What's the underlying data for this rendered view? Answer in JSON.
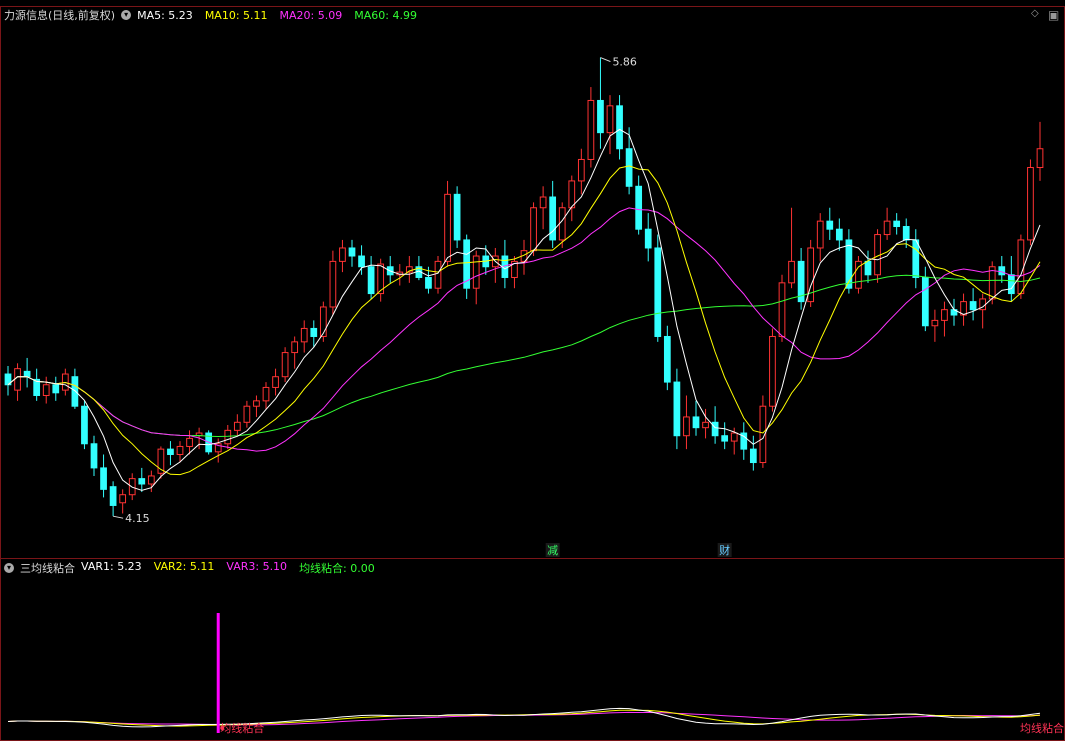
{
  "main": {
    "title": "力源信息(日线,前复权)",
    "ma_labels": [
      {
        "key": "MA5",
        "text": "MA5: 5.23",
        "color": "#ffffff"
      },
      {
        "key": "MA10",
        "text": "MA10: 5.11",
        "color": "#ffff00"
      },
      {
        "key": "MA20",
        "text": "MA20: 5.09",
        "color": "#ff33ff"
      },
      {
        "key": "MA60",
        "text": "MA60: 4.99",
        "color": "#33ff33"
      }
    ],
    "high_label": "5.86",
    "low_label": "4.15",
    "event_tags": [
      {
        "text": "减",
        "color": "#33ff66",
        "bar": 57
      },
      {
        "text": "财",
        "color": "#66ccff",
        "bar": 75
      }
    ]
  },
  "sub": {
    "title": "三均线粘合",
    "var_labels": [
      {
        "text": "VAR1: 5.23",
        "color": "#ffffff"
      },
      {
        "text": "VAR2: 5.11",
        "color": "#ffff00"
      },
      {
        "text": "VAR3: 5.10",
        "color": "#ff33ff"
      },
      {
        "text": "均线粘合: 0.00",
        "color": "#33ff33"
      }
    ],
    "signal_label": "均线粘合",
    "signals": [
      {
        "bar": 22,
        "label": "均线粘合"
      },
      {
        "bar": 116,
        "label": "均线粘合"
      }
    ]
  },
  "colors": {
    "up": "#ff3333",
    "down": "#33ffff",
    "frame": "#7a1518",
    "ma5": "#ffffff",
    "ma10": "#ffff00",
    "ma20": "#ff33ff",
    "ma60": "#33ff33",
    "signal": "#ff00ff",
    "signal_text": "#ff3355"
  },
  "chart_data": {
    "type": "candlestick",
    "series_count": 118,
    "y_range": [
      4.05,
      6.0
    ],
    "y_extremes": {
      "max": 5.86,
      "min": 4.15
    },
    "ohlc": [
      [
        4.68,
        4.71,
        4.6,
        4.64
      ],
      [
        4.62,
        4.72,
        4.58,
        4.7
      ],
      [
        4.69,
        4.74,
        4.63,
        4.67
      ],
      [
        4.66,
        4.7,
        4.58,
        4.6
      ],
      [
        4.6,
        4.67,
        4.57,
        4.64
      ],
      [
        4.64,
        4.67,
        4.58,
        4.61
      ],
      [
        4.62,
        4.7,
        4.6,
        4.68
      ],
      [
        4.67,
        4.7,
        4.55,
        4.56
      ],
      [
        4.56,
        4.58,
        4.4,
        4.42
      ],
      [
        4.42,
        4.45,
        4.3,
        4.33
      ],
      [
        4.33,
        4.38,
        4.22,
        4.25
      ],
      [
        4.26,
        4.28,
        4.15,
        4.19
      ],
      [
        4.2,
        4.25,
        4.16,
        4.23
      ],
      [
        4.23,
        4.31,
        4.21,
        4.29
      ],
      [
        4.29,
        4.33,
        4.24,
        4.27
      ],
      [
        4.27,
        4.32,
        4.24,
        4.3
      ],
      [
        4.31,
        4.41,
        4.29,
        4.4
      ],
      [
        4.4,
        4.43,
        4.34,
        4.38
      ],
      [
        4.38,
        4.43,
        4.35,
        4.41
      ],
      [
        4.41,
        4.47,
        4.38,
        4.44
      ],
      [
        4.45,
        4.48,
        4.4,
        4.46
      ],
      [
        4.46,
        4.47,
        4.38,
        4.39
      ],
      [
        4.39,
        4.44,
        4.35,
        4.42
      ],
      [
        4.42,
        4.49,
        4.4,
        4.47
      ],
      [
        4.47,
        4.53,
        4.45,
        4.5
      ],
      [
        4.5,
        4.58,
        4.48,
        4.56
      ],
      [
        4.56,
        4.6,
        4.52,
        4.58
      ],
      [
        4.58,
        4.65,
        4.55,
        4.63
      ],
      [
        4.63,
        4.7,
        4.6,
        4.67
      ],
      [
        4.67,
        4.78,
        4.65,
        4.76
      ],
      [
        4.76,
        4.82,
        4.7,
        4.8
      ],
      [
        4.8,
        4.88,
        4.76,
        4.85
      ],
      [
        4.85,
        4.88,
        4.78,
        4.82
      ],
      [
        4.82,
        4.95,
        4.8,
        4.93
      ],
      [
        4.93,
        5.14,
        4.9,
        5.1
      ],
      [
        5.1,
        5.18,
        5.06,
        5.15
      ],
      [
        5.15,
        5.18,
        5.08,
        5.12
      ],
      [
        5.12,
        5.16,
        5.05,
        5.08
      ],
      [
        5.08,
        5.12,
        4.96,
        4.98
      ],
      [
        4.98,
        5.11,
        4.95,
        5.09
      ],
      [
        5.08,
        5.12,
        5.02,
        5.05
      ],
      [
        5.05,
        5.09,
        5.01,
        5.06
      ],
      [
        5.06,
        5.12,
        5.02,
        5.08
      ],
      [
        5.08,
        5.12,
        5.03,
        5.04
      ],
      [
        5.04,
        5.08,
        4.98,
        5.0
      ],
      [
        5.0,
        5.12,
        4.98,
        5.1
      ],
      [
        5.1,
        5.4,
        5.08,
        5.35
      ],
      [
        5.35,
        5.38,
        5.15,
        5.18
      ],
      [
        5.18,
        5.2,
        4.96,
        5.0
      ],
      [
        5.0,
        5.14,
        4.94,
        5.12
      ],
      [
        5.12,
        5.16,
        5.05,
        5.08
      ],
      [
        5.08,
        5.15,
        5.02,
        5.12
      ],
      [
        5.12,
        5.18,
        5.0,
        5.04
      ],
      [
        5.04,
        5.12,
        5.0,
        5.1
      ],
      [
        5.1,
        5.18,
        5.05,
        5.14
      ],
      [
        5.14,
        5.32,
        5.12,
        5.3
      ],
      [
        5.3,
        5.38,
        5.22,
        5.34
      ],
      [
        5.34,
        5.4,
        5.15,
        5.18
      ],
      [
        5.18,
        5.32,
        5.15,
        5.3
      ],
      [
        5.3,
        5.42,
        5.25,
        5.4
      ],
      [
        5.4,
        5.52,
        5.35,
        5.48
      ],
      [
        5.48,
        5.75,
        5.45,
        5.7
      ],
      [
        5.7,
        5.86,
        5.52,
        5.58
      ],
      [
        5.58,
        5.72,
        5.5,
        5.68
      ],
      [
        5.68,
        5.72,
        5.48,
        5.52
      ],
      [
        5.52,
        5.6,
        5.35,
        5.38
      ],
      [
        5.38,
        5.42,
        5.2,
        5.22
      ],
      [
        5.22,
        5.28,
        5.1,
        5.15
      ],
      [
        5.15,
        5.2,
        4.8,
        4.82
      ],
      [
        4.82,
        4.86,
        4.62,
        4.65
      ],
      [
        4.65,
        4.7,
        4.4,
        4.45
      ],
      [
        4.45,
        4.6,
        4.4,
        4.52
      ],
      [
        4.52,
        4.58,
        4.45,
        4.48
      ],
      [
        4.48,
        4.55,
        4.44,
        4.5
      ],
      [
        4.5,
        4.56,
        4.42,
        4.45
      ],
      [
        4.45,
        4.5,
        4.4,
        4.43
      ],
      [
        4.43,
        4.48,
        4.38,
        4.46
      ],
      [
        4.46,
        4.5,
        4.36,
        4.4
      ],
      [
        4.4,
        4.45,
        4.32,
        4.35
      ],
      [
        4.35,
        4.6,
        4.33,
        4.56
      ],
      [
        4.56,
        4.85,
        4.54,
        4.82
      ],
      [
        4.82,
        5.05,
        4.8,
        5.02
      ],
      [
        5.02,
        5.3,
        5.0,
        5.1
      ],
      [
        5.1,
        5.15,
        4.92,
        4.95
      ],
      [
        4.95,
        5.18,
        4.93,
        5.15
      ],
      [
        5.15,
        5.28,
        5.1,
        5.25
      ],
      [
        5.25,
        5.3,
        5.18,
        5.22
      ],
      [
        5.22,
        5.26,
        5.14,
        5.18
      ],
      [
        5.18,
        5.22,
        4.98,
        5.0
      ],
      [
        5.0,
        5.12,
        4.98,
        5.1
      ],
      [
        5.1,
        5.14,
        5.02,
        5.05
      ],
      [
        5.05,
        5.22,
        5.02,
        5.2
      ],
      [
        5.2,
        5.3,
        5.18,
        5.25
      ],
      [
        5.25,
        5.28,
        5.2,
        5.23
      ],
      [
        5.23,
        5.26,
        5.15,
        5.18
      ],
      [
        5.18,
        5.22,
        5.0,
        5.04
      ],
      [
        5.04,
        5.08,
        4.84,
        4.86
      ],
      [
        4.86,
        4.92,
        4.8,
        4.88
      ],
      [
        4.88,
        4.95,
        4.82,
        4.92
      ],
      [
        4.92,
        4.96,
        4.86,
        4.9
      ],
      [
        4.9,
        4.98,
        4.86,
        4.95
      ],
      [
        4.95,
        5.0,
        4.88,
        4.92
      ],
      [
        4.92,
        4.98,
        4.85,
        4.96
      ],
      [
        4.96,
        5.1,
        4.94,
        5.08
      ],
      [
        5.08,
        5.12,
        5.02,
        5.05
      ],
      [
        5.05,
        5.12,
        4.95,
        4.98
      ],
      [
        4.98,
        5.2,
        4.96,
        5.18
      ],
      [
        5.18,
        5.48,
        5.16,
        5.45
      ],
      [
        5.45,
        5.62,
        5.4,
        5.52
      ]
    ]
  }
}
